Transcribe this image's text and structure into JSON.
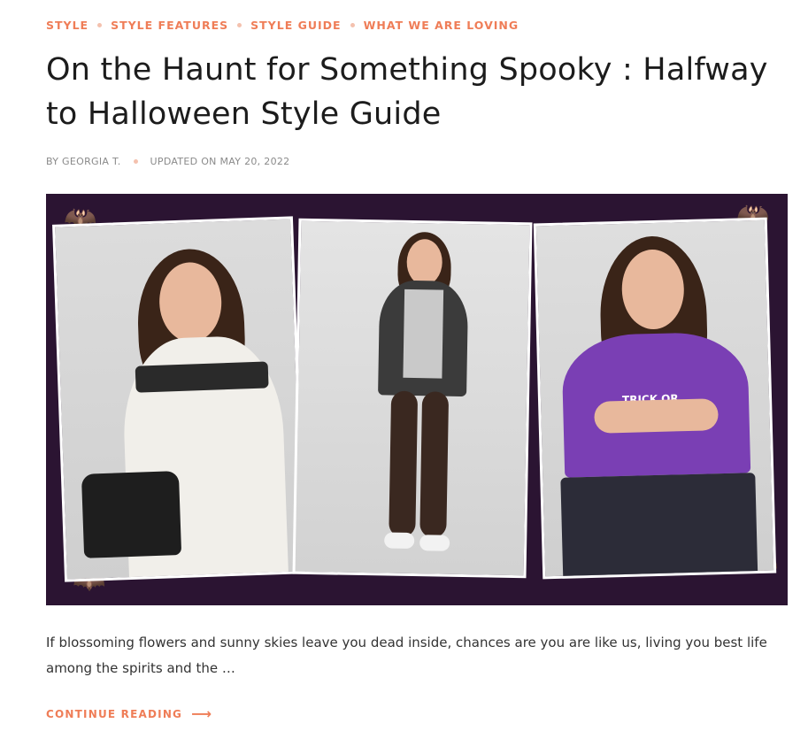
{
  "categories": [
    "STYLE",
    "STYLE FEATURES",
    "STYLE GUIDE",
    "WHAT WE ARE LOVING"
  ],
  "title": "On the Haunt for Something Spooky : Halfway to Halloween Style Guide",
  "meta": {
    "author": "BY GEORGIA T.",
    "updated": "UPDATED ON MAY 20, 2022"
  },
  "hero": {
    "tee_text": "TRICK OR"
  },
  "excerpt": "If blossoming flowers and sunny skies leave you dead inside, chances are you are like us, living you best life among the spirits and the …",
  "continue_label": "CONTINUE READING",
  "colors": {
    "accent": "#ef7d57",
    "hero_bg": "#2b1432"
  },
  "icons": {
    "continue": "arrow-right-icon"
  }
}
